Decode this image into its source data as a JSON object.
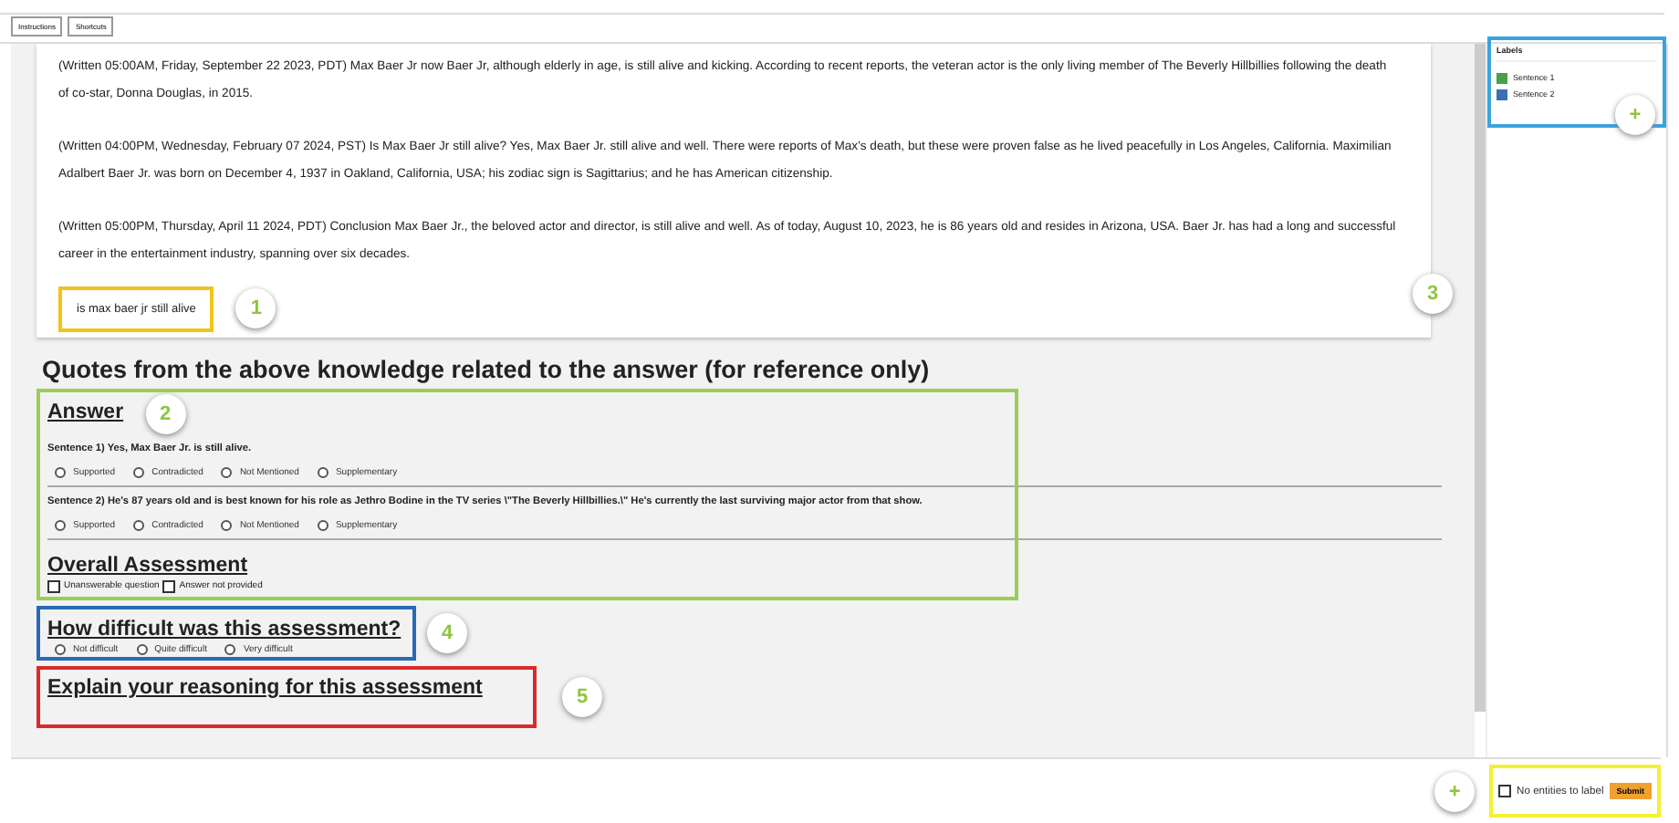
{
  "toolbar": {
    "buttons": [
      "Instructions",
      "Shortcuts"
    ]
  },
  "passages": [
    "(Written 05:00AM, Friday, September 22 2023, PDT) Max Baer Jr now Baer Jr, although elderly in age, is still alive and kicking. According to recent reports, the veteran actor is the only living member of The Beverly Hillbillies following the death of co-star, Donna Douglas, in 2015.",
    "(Written 04:00PM, Wednesday, February 07 2024, PST) Is Max Baer Jr still alive? Yes, Max Baer Jr. still alive and well. There were reports of Max's death, but these were proven false as he lived peacefully in Los Angeles, California. Maximilian Adalbert Baer Jr. was born on December 4, 1937 in Oakland, California, USA; his zodiac sign is Sagittarius; and he has American citizenship.",
    "(Written 05:00PM, Thursday, April 11 2024, PDT) Conclusion Max Baer Jr., the beloved actor and director, is still alive and well. As of today, August 10, 2023, he is 86 years old and resides in Arizona, USA. Baer Jr. has had a long and successful career in the entertainment industry, spanning over six decades."
  ],
  "question": {
    "text": "is max baer jr still alive",
    "callout": "1"
  },
  "scroll_callout": "3",
  "quotes_heading": "Quotes from the above knowledge related to the answer (for reference only)",
  "answer_section": {
    "title": "Answer",
    "callout": "2",
    "sentences": [
      {
        "text": "Sentence 1) Yes, Max Baer Jr. is still alive.",
        "options": [
          {
            "label": "Supported",
            "selected": false
          },
          {
            "label": "Contradicted",
            "selected": false
          },
          {
            "label": "Not Mentioned",
            "selected": false
          },
          {
            "label": "Supplementary",
            "selected": false
          }
        ]
      },
      {
        "text": "Sentence 2) He's 87 years old and is best known for his role as Jethro Bodine in the TV series \\\"The Beverly Hillbillies.\\\" He's currently the last surviving major actor from that show.",
        "options": [
          {
            "label": "Supported",
            "selected": false
          },
          {
            "label": "Contradicted",
            "selected": false
          },
          {
            "label": "Not Mentioned",
            "selected": false
          },
          {
            "label": "Supplementary",
            "selected": false
          }
        ]
      }
    ],
    "overall": {
      "title": "Overall Assessment",
      "checkboxes": [
        {
          "label": "Unanswerable question",
          "checked": false
        },
        {
          "label": "Answer not provided",
          "checked": false
        }
      ]
    }
  },
  "difficulty": {
    "title": "How difficult was this assessment?",
    "callout": "4",
    "options": [
      {
        "label": "Not difficult",
        "selected": false
      },
      {
        "label": "Quite difficult",
        "selected": false
      },
      {
        "label": "Very difficult",
        "selected": false
      }
    ]
  },
  "reasoning": {
    "title": "Explain your reasoning for this assessment",
    "callout": "5"
  },
  "labels_panel": {
    "title": "Labels",
    "callout": "+",
    "items": [
      {
        "name": "Sentence 1",
        "color": "#4aa04a"
      },
      {
        "name": "Sentence 2",
        "color": "#3a6fb5"
      }
    ]
  },
  "footer": {
    "callout": "+",
    "no_entities": {
      "label": "No entities to label",
      "checked": false
    },
    "submit": "Submit"
  }
}
